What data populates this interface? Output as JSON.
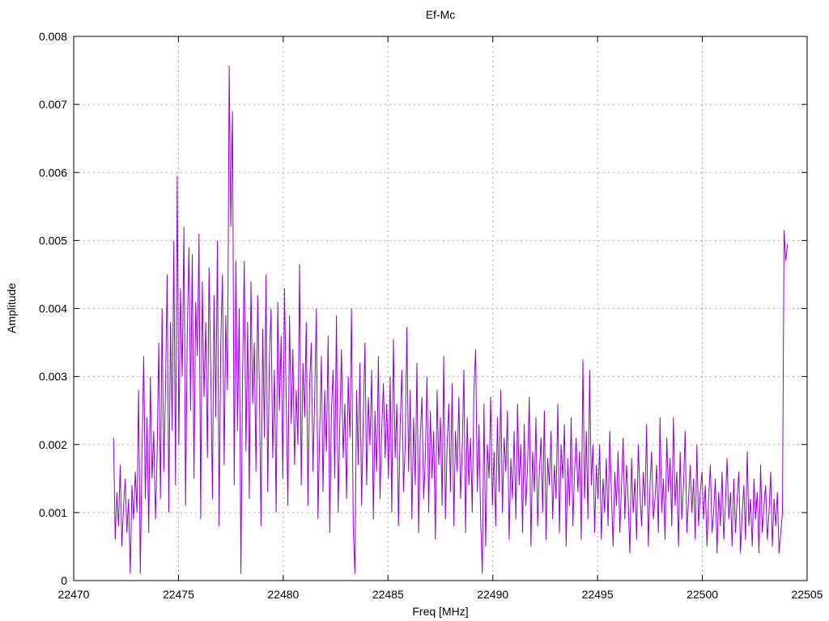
{
  "chart_data": {
    "type": "line",
    "title": "Ef-Mc",
    "xlabel": "Freq [MHz]",
    "ylabel": "Amplitude",
    "xlim": [
      22470,
      22505
    ],
    "ylim": [
      0,
      0.008
    ],
    "grid": true,
    "legend_position": "none",
    "line_color": "#9400d3",
    "grid_color": "#ababab",
    "border_color": "#000000",
    "x_ticks": [
      {
        "v": 22470,
        "label": "22470"
      },
      {
        "v": 22475,
        "label": "22475"
      },
      {
        "v": 22480,
        "label": "22480"
      },
      {
        "v": 22485,
        "label": "22485"
      },
      {
        "v": 22490,
        "label": "22490"
      },
      {
        "v": 22495,
        "label": "22495"
      },
      {
        "v": 22500,
        "label": "22500"
      },
      {
        "v": 22505,
        "label": "22505"
      }
    ],
    "y_ticks": [
      {
        "v": 0,
        "label": "0"
      },
      {
        "v": 0.001,
        "label": "0.001"
      },
      {
        "v": 0.002,
        "label": "0.002"
      },
      {
        "v": 0.003,
        "label": "0.003"
      },
      {
        "v": 0.004,
        "label": "0.004"
      },
      {
        "v": 0.005,
        "label": "0.005"
      },
      {
        "v": 0.006,
        "label": "0.006"
      },
      {
        "v": 0.007,
        "label": "0.007"
      },
      {
        "v": 0.008,
        "label": "0.008"
      }
    ],
    "series": [
      {
        "name": "Ef-Mc",
        "x_start": 22471.9,
        "x_step": 0.08,
        "y_unit": 0.0001,
        "y_values": [
          21,
          6,
          13,
          8,
          17,
          5,
          11,
          15,
          7,
          12,
          1,
          14,
          9,
          16,
          10,
          28,
          1,
          19,
          33,
          12,
          24,
          7,
          30,
          15,
          22,
          9,
          18,
          35,
          12,
          40,
          16,
          28,
          45,
          10,
          38,
          22,
          50,
          14,
          59.5,
          20,
          43,
          30,
          52,
          11,
          36,
          49,
          25,
          48,
          15,
          41,
          33,
          51,
          9,
          44,
          27,
          38,
          18,
          46,
          31,
          12,
          42,
          24,
          50,
          8,
          35,
          45,
          17,
          39,
          28,
          75.7,
          52,
          69,
          14,
          47,
          22,
          40,
          1,
          30,
          47,
          19,
          38,
          12,
          44,
          26,
          35,
          16,
          42,
          29,
          8,
          37,
          21,
          45,
          13,
          33,
          40,
          18,
          31,
          10,
          41,
          25,
          36,
          15,
          43,
          27,
          11,
          39,
          23,
          34,
          17,
          28,
          20,
          46.5,
          14,
          32,
          24,
          38,
          11,
          29,
          35,
          16,
          27,
          40,
          9,
          22,
          33,
          13,
          28,
          19,
          36,
          7,
          25,
          31,
          15,
          39,
          10,
          23,
          34,
          18,
          26,
          12,
          30,
          21,
          40,
          8,
          1,
          28,
          17,
          32,
          11,
          24,
          35,
          14,
          27,
          20,
          31,
          9,
          25,
          16,
          33,
          12,
          22,
          29,
          18,
          26,
          15,
          30,
          10,
          35.5,
          18,
          26,
          8,
          23,
          31,
          13,
          20,
          37.3,
          16,
          28,
          9,
          24,
          14,
          32,
          7,
          21,
          27,
          12,
          18,
          30,
          10,
          25,
          15,
          22,
          6,
          28,
          17,
          24,
          11,
          33,
          9,
          20,
          26,
          13,
          29,
          8,
          22,
          16,
          27,
          12,
          19,
          31,
          7,
          24,
          14,
          21,
          10,
          28,
          34,
          13,
          23,
          9,
          1,
          26,
          5,
          20,
          15,
          27,
          11,
          19,
          8,
          24,
          13,
          28,
          10,
          21,
          16,
          25,
          6,
          18,
          12,
          22,
          9,
          26,
          14,
          20,
          7,
          23,
          11,
          17,
          27,
          5,
          19,
          13,
          24,
          8,
          16,
          21,
          10,
          25,
          6,
          18,
          14,
          22,
          9,
          17,
          12,
          26,
          7,
          20,
          15,
          23,
          5,
          18,
          11,
          24,
          8,
          16,
          21,
          13,
          19,
          6,
          32.5,
          12,
          22,
          9,
          31,
          14,
          20,
          7,
          17,
          12,
          20,
          6,
          15,
          10,
          18,
          8,
          22,
          13,
          5,
          16,
          11,
          19,
          7,
          14,
          21,
          9,
          17,
          12,
          4,
          18,
          10,
          15,
          6,
          20,
          13,
          8,
          16,
          11,
          23,
          5,
          14,
          19,
          9,
          12,
          17,
          7,
          24,
          10,
          15,
          6,
          21,
          13,
          18,
          8,
          24,
          11,
          16,
          5,
          19,
          9,
          14,
          22,
          7,
          12,
          17,
          10,
          15,
          6,
          20,
          8,
          13,
          16,
          9,
          14,
          5,
          12,
          17,
          7,
          10,
          15,
          4,
          13,
          8,
          16,
          6,
          11,
          18,
          9,
          13,
          5,
          15,
          7,
          12,
          16,
          4,
          10,
          14,
          6,
          19,
          8,
          12,
          5,
          15,
          9,
          13,
          4,
          17,
          7,
          11,
          14,
          6,
          10,
          16,
          5,
          12,
          8,
          13,
          4,
          7,
          10,
          51.5,
          47,
          49.5
        ]
      }
    ]
  }
}
